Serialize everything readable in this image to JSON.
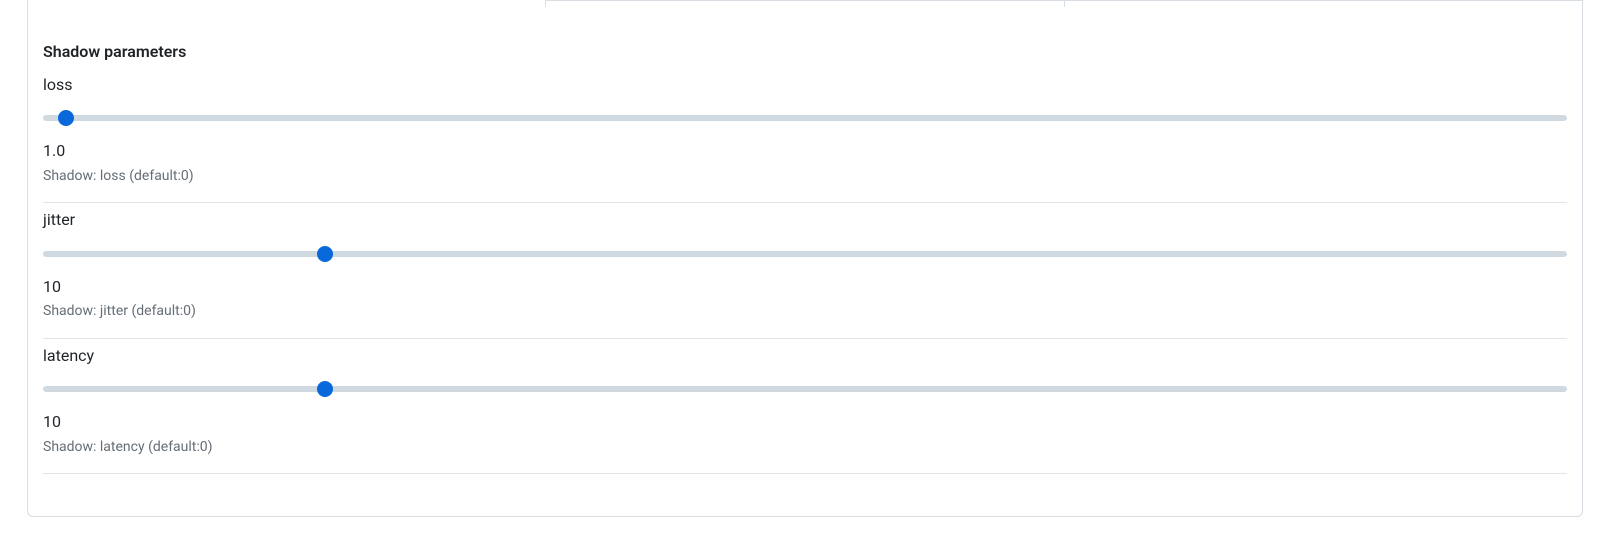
{
  "section": {
    "title": "Shadow parameters"
  },
  "params": {
    "loss": {
      "label": "loss",
      "value": "1.0",
      "description": "Shadow: loss (default:0)",
      "position_percent": 1.5
    },
    "jitter": {
      "label": "jitter",
      "value": "10",
      "description": "Shadow: jitter (default:0)",
      "position_percent": 18.5
    },
    "latency": {
      "label": "latency",
      "value": "10",
      "description": "Shadow: latency (default:0)",
      "position_percent": 18.5
    }
  },
  "colors": {
    "accent": "#0969da",
    "track": "#d1d9e0",
    "border": "#d8dee4",
    "text": "#1f2328",
    "muted": "#656d76"
  }
}
